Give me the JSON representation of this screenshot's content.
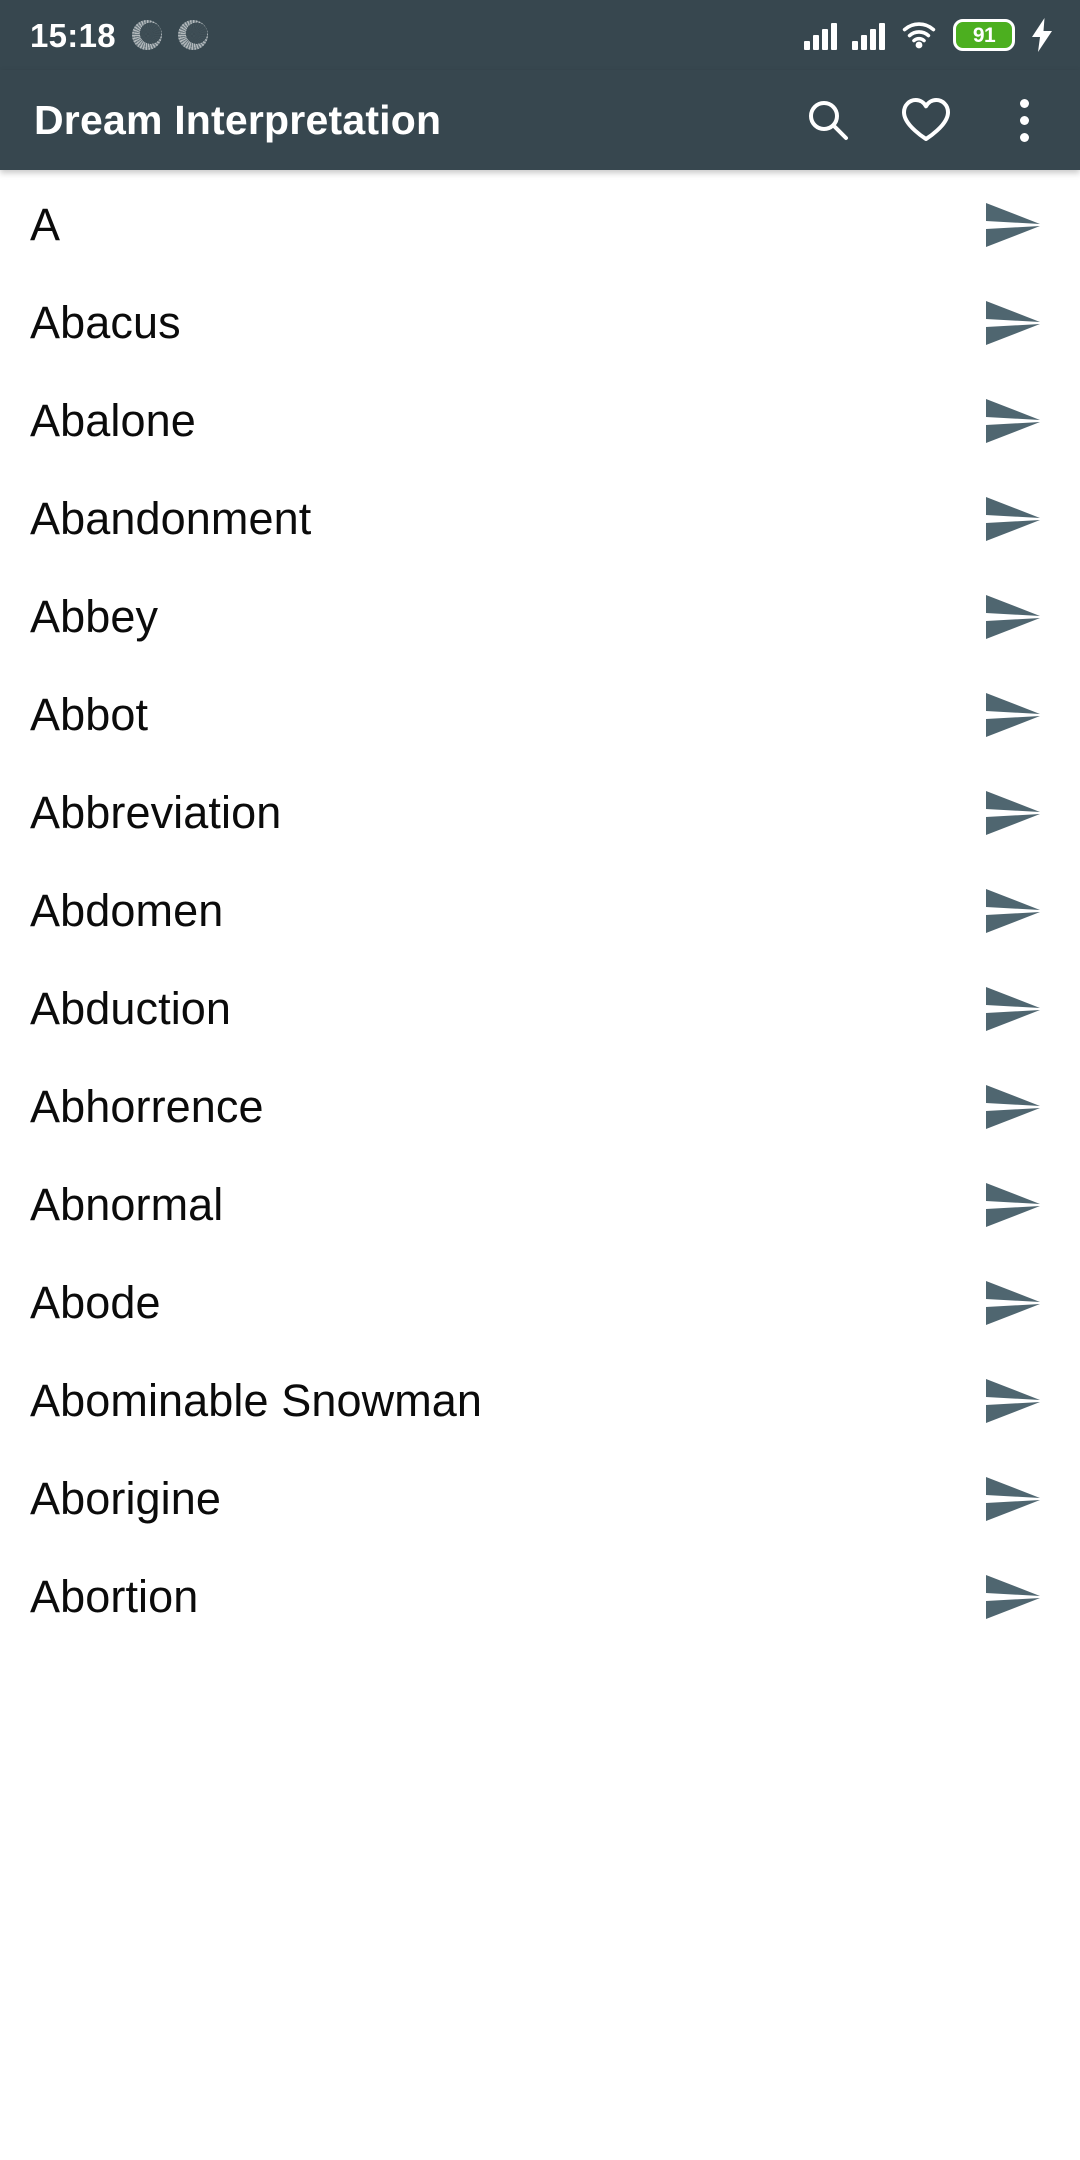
{
  "status_bar": {
    "time": "15:18",
    "notification_icons": [
      "notification-dot-icon",
      "notification-dot-icon"
    ],
    "signal_icons": [
      "signal-bars-icon",
      "signal-bars-icon"
    ],
    "wifi_icon": "wifi-icon",
    "battery_level": "91",
    "battery_icon": "battery-icon",
    "charging_icon": "charging-bolt-icon",
    "background_color": "#37474f"
  },
  "app_bar": {
    "title": "Dream Interpretation",
    "background_color": "#37474f",
    "title_color": "#ffffff",
    "actions": [
      {
        "name": "search-button",
        "icon": "search-icon"
      },
      {
        "name": "favorites-button",
        "icon": "heart-icon"
      },
      {
        "name": "overflow-menu-button",
        "icon": "kebab-menu-icon"
      }
    ]
  },
  "list": {
    "row_icon": "send-arrow-icon",
    "row_icon_color": "#4f6670",
    "text_color": "#0b0b0b",
    "background_color": "#ffffff",
    "items": [
      {
        "label": "A"
      },
      {
        "label": "Abacus"
      },
      {
        "label": "Abalone"
      },
      {
        "label": "Abandonment"
      },
      {
        "label": "Abbey"
      },
      {
        "label": "Abbot"
      },
      {
        "label": "Abbreviation"
      },
      {
        "label": "Abdomen"
      },
      {
        "label": "Abduction"
      },
      {
        "label": "Abhorrence"
      },
      {
        "label": "Abnormal"
      },
      {
        "label": "Abode"
      },
      {
        "label": "Abominable Snowman"
      },
      {
        "label": "Aborigine"
      },
      {
        "label": "Abortion"
      }
    ]
  }
}
